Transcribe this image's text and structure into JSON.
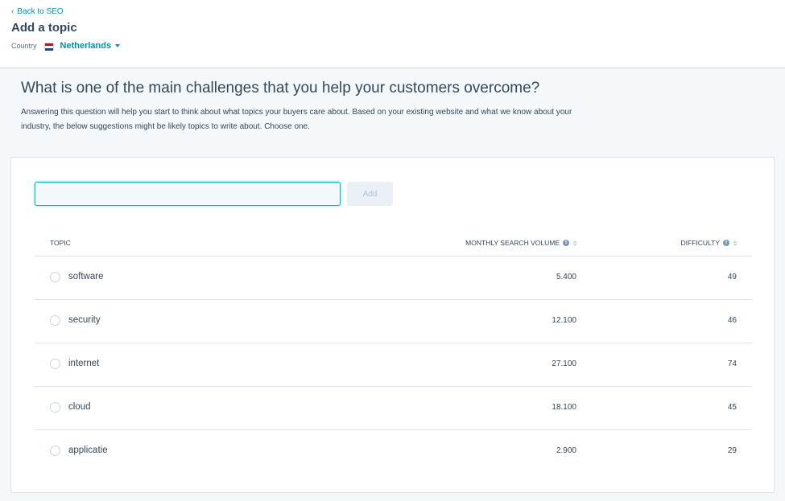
{
  "header": {
    "back_label": "Back to SEO",
    "title": "Add a topic",
    "country_label": "Country",
    "country_value": "Netherlands"
  },
  "intro": {
    "question": "What is one of the main challenges that you help your customers overcome?",
    "description": "Answering this question will help you start to think about what topics your buyers care about. Based on your existing website and what we know about your industry, the below suggestions might be likely topics to write about. Choose one."
  },
  "form": {
    "input_value": "",
    "input_placeholder": "",
    "add_label": "Add"
  },
  "table": {
    "columns": {
      "topic": "TOPIC",
      "volume": "MONTHLY SEARCH VOLUME",
      "difficulty": "DIFFICULTY"
    },
    "rows": [
      {
        "topic": "software",
        "volume": "5.400",
        "difficulty": "49"
      },
      {
        "topic": "security",
        "volume": "12.100",
        "difficulty": "46"
      },
      {
        "topic": "internet",
        "volume": "27.100",
        "difficulty": "74"
      },
      {
        "topic": "cloud",
        "volume": "18.100",
        "difficulty": "45"
      },
      {
        "topic": "applicatie",
        "volume": "2.900",
        "difficulty": "29"
      }
    ]
  },
  "colors": {
    "link": "#0091ae",
    "text": "#33475b",
    "input_focus_border": "#00bda5",
    "page_background": "#f5f8fa"
  },
  "icons": {
    "back": "chevron-left-icon",
    "flag": "netherlands-flag-icon",
    "dropdown": "caret-down-icon",
    "info": "info-icon",
    "sort": "sort-icon",
    "radio": "radio-icon"
  }
}
